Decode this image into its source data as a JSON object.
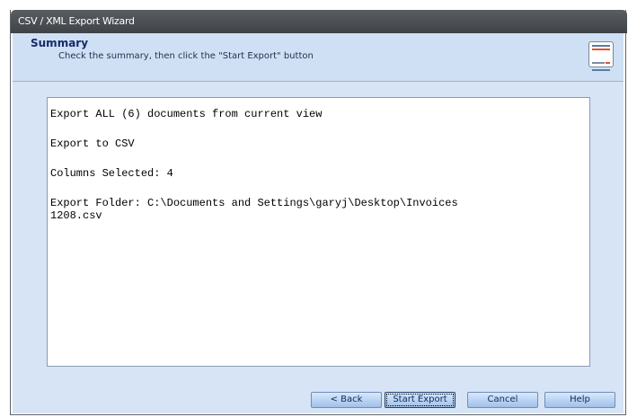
{
  "window": {
    "title": "CSV / XML Export Wizard"
  },
  "header": {
    "title": "Summary",
    "subtitle": "Check the summary, then click the \"Start Export\" button",
    "icon": "table-export-icon"
  },
  "summary": {
    "line1": "Export ALL (6) documents from current view",
    "line2": "Export to CSV",
    "line3": "Columns Selected: 4",
    "line4": "Export Folder: C:\\Documents and Settings\\garyj\\Desktop\\Invoices",
    "line5": "1208.csv"
  },
  "buttons": {
    "back": "< Back",
    "start": "Start Export",
    "cancel": "Cancel",
    "help": "Help"
  },
  "colors": {
    "titlebar": "#4a4e52",
    "header_bg": "#cfe0f5",
    "body_bg": "#d6e4f5",
    "button_bg": "#b8d1f2",
    "icon_accent": "#e1542a"
  }
}
